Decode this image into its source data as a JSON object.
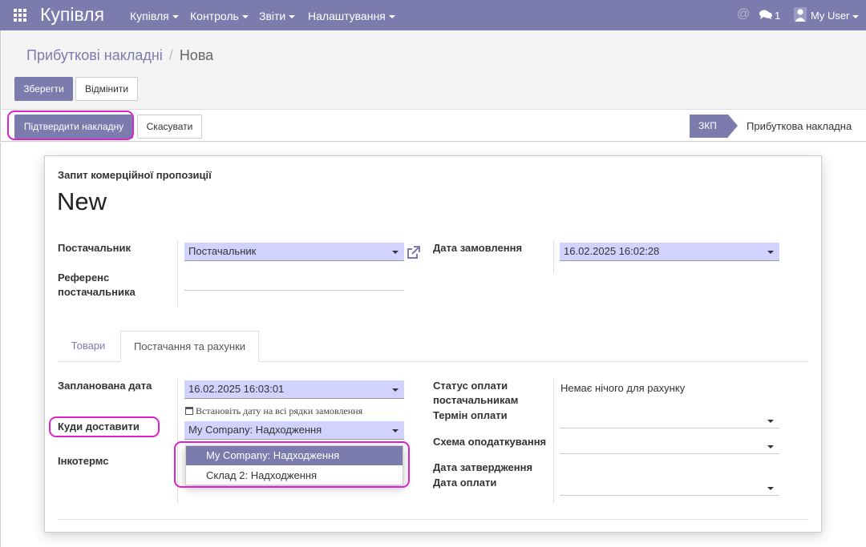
{
  "navbar": {
    "app_name": "Купівля",
    "menus": [
      "Купівля",
      "Контроль",
      "Звіти",
      "Налаштування"
    ],
    "chat_count": "1",
    "user": "My User",
    "accent_color": "#7c7bad"
  },
  "breadcrumb": {
    "parent": "Прибуткові накладні",
    "current": "Нова"
  },
  "toolbar": {
    "save_label": "Зберегти",
    "discard_label": "Відмінити"
  },
  "statusbar": {
    "confirm_label": "Підтвердити накладну",
    "cancel_label": "Скасувати",
    "stages": [
      "ЗКП",
      "Прибуткова накладна"
    ]
  },
  "form": {
    "subtitle": "Запит комерційної пропозиції",
    "title": "New",
    "vendor_label": "Постачальник",
    "vendor_value": "Постачальник",
    "vendor_ref_label": "Референс постачальника",
    "order_date_label": "Дата замовлення",
    "order_date_value": "16.02.2025 16:02:28"
  },
  "tabs": [
    "Товари",
    "Постачання та рахунки"
  ],
  "delivery": {
    "planned_date_label": "Запланована дата",
    "planned_date_value": "16.02.2025 16:03:01",
    "planned_date_hint": "Встановіть дату на всі рядки замовлення",
    "deliver_to_label": "Куди доставити",
    "deliver_to_value": "My Company: Надходження",
    "incoterms_label": "Інкотермс",
    "dropdown_options": [
      "My Company: Надходження",
      "Склад 2: Надходження"
    ],
    "billing_status_label": "Статус оплати постачальникам",
    "billing_status_value": "Немає нічого для рахунку",
    "payment_term_label": "Термін оплати",
    "fiscal_position_label": "Схема оподаткування",
    "approve_date_label": "Дата затвердження",
    "payment_date_label": "Дата оплати"
  }
}
